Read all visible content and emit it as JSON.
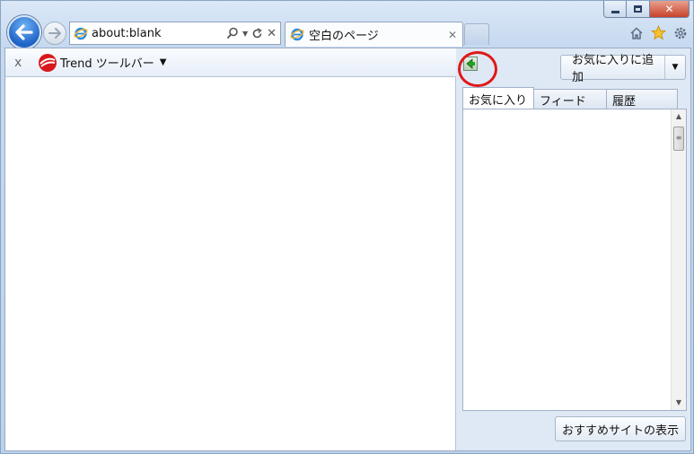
{
  "window": {
    "controls": {
      "minimize_icon": "minimize-icon",
      "maximize_icon": "maximize-icon",
      "close_icon": "close-icon"
    }
  },
  "nav": {
    "back_icon": "back-arrow-icon",
    "forward_icon": "forward-arrow-icon",
    "address": {
      "value": "about:blank"
    }
  },
  "tabs": [
    {
      "title": "空白のページ",
      "close_glyph": "✕"
    }
  ],
  "toolbar_icons": [
    "home-icon",
    "favorites-star-icon",
    "settings-gear-icon"
  ],
  "trend_toolbar": {
    "close_glyph": "x",
    "label": "Trend ツールバー",
    "caret": "▼"
  },
  "favorites_center": {
    "add_button_label": "お気に入りに追加",
    "add_button_caret": "▼",
    "tabs": [
      "お気に入り",
      "フィード",
      "履歴"
    ],
    "active_tab": "お気に入り",
    "recommend_button_label": "おすすめサイトの表示"
  },
  "colors": {
    "highlight": "#e01818",
    "accent": "#1f63c6"
  }
}
